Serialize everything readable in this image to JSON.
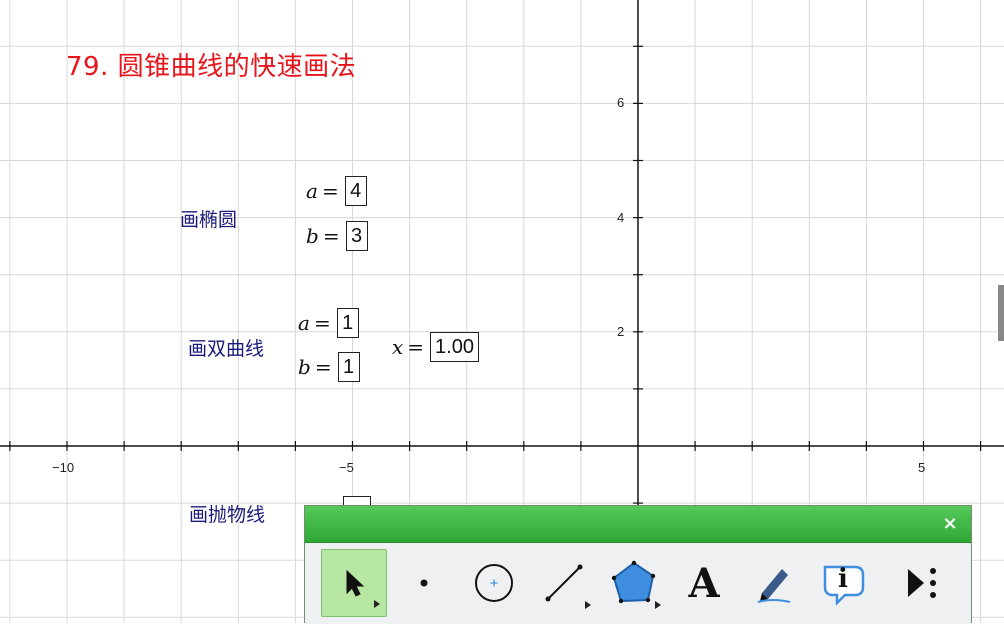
{
  "title": "79. 圆锥曲线的快速画法",
  "ellipse": {
    "label": "画椭圆",
    "a_var": "a",
    "a_value": "4",
    "b_var": "b",
    "b_value": "3"
  },
  "hyperbola": {
    "label": "画双曲线",
    "a_var": "a",
    "a_value": "1",
    "b_var": "b",
    "b_value": "1",
    "x_var": "x",
    "x_value": "1.00"
  },
  "parabola": {
    "label": "画抛物线"
  },
  "axes": {
    "x_ticks": [
      "−10",
      "−5",
      "5"
    ],
    "y_ticks": [
      "6",
      "4",
      "2"
    ]
  },
  "toolbar": {
    "close_label": "×",
    "tools": [
      {
        "name": "move-tool",
        "icon": "arrow-pointer-icon"
      },
      {
        "name": "point-tool",
        "icon": "dot-icon"
      },
      {
        "name": "compass-tool",
        "icon": "circle-icon"
      },
      {
        "name": "line-tool",
        "icon": "segment-icon"
      },
      {
        "name": "polygon-tool",
        "icon": "pentagon-icon"
      },
      {
        "name": "text-tool",
        "icon": "text-A-icon"
      },
      {
        "name": "marker-tool",
        "icon": "pen-icon"
      },
      {
        "name": "info-tool",
        "icon": "info-icon"
      },
      {
        "name": "custom-tool",
        "icon": "play-more-icon"
      }
    ],
    "text_tool_glyph": "A",
    "info_glyph": "i"
  },
  "colors": {
    "title": "#e8141b",
    "label": "#1a1a7a",
    "toolbar_header": "#3cb842",
    "active_tool": "#b7e7a3",
    "polygon_fill": "#3f8ee0"
  }
}
